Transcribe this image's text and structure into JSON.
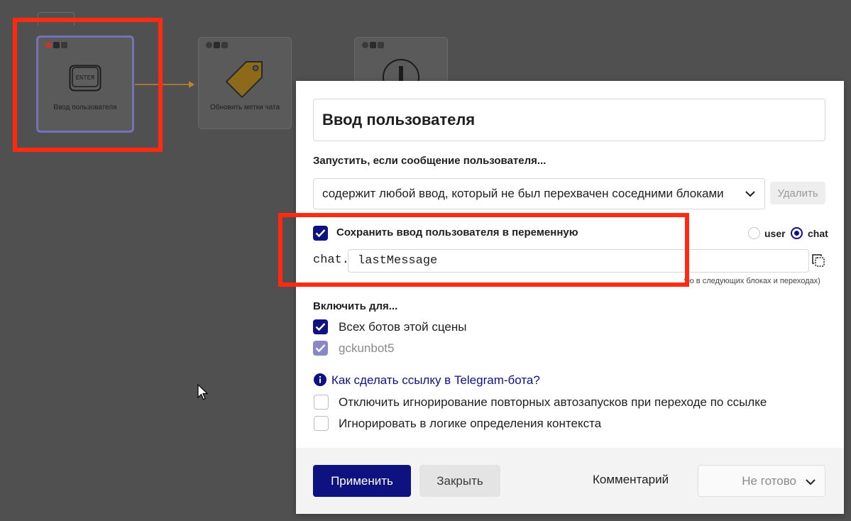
{
  "canvas": {
    "nodes": [
      {
        "label": "Ввод пользователя",
        "icon": "enter-key-icon",
        "key_text": "ENTER"
      },
      {
        "label": "Обновить метки чата",
        "icon": "tag-icon"
      },
      {
        "label": "",
        "icon": "exclamation-icon"
      }
    ]
  },
  "panel": {
    "title": "Ввод пользователя",
    "trigger_label": "Запустить, если сообщение пользователя...",
    "trigger_value": "содержит любой ввод, который не был перехвачен соседними блоками",
    "delete_label": "Удалить",
    "save_checkbox_label": "Сохранить ввод пользователя в переменную",
    "scope_user": "user",
    "scope_chat": "chat",
    "var_prefix": "chat.",
    "var_name": "lastMessage",
    "hint": "ую в следующих блоках и переходах)",
    "enable_for_label": "Включить для...",
    "all_bots_label": "Всех ботов этой сцены",
    "bot_name": "gckunbot5",
    "telegram_link": "Как сделать ссылку в Telegram-бота?",
    "disable_ignore_label": "Отключить игнорирование повторных автозапусков при переходе по ссылке",
    "ignore_context_label": "Игнорировать в логике определения контекста"
  },
  "footer": {
    "apply_label": "Применить",
    "close_label": "Закрыть",
    "comment_label": "Комментарий",
    "status_value": "Не готово"
  },
  "colors": {
    "accent": "#0e1280",
    "highlight": "#ff2a10",
    "canvas_bg": "#505050"
  }
}
